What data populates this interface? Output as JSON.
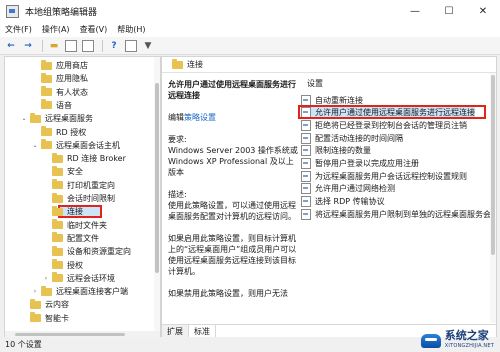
{
  "window": {
    "title": "本地组策略编辑器",
    "controls": {
      "minimize": "—",
      "maximize": "☐",
      "close": "✕"
    }
  },
  "menu": [
    "文件(F)",
    "操作(A)",
    "查看(V)",
    "帮助(H)"
  ],
  "toolbar": [
    "back-arrow-icon",
    "forward-arrow-icon",
    "up-folder-icon",
    "show-hide-tree-icon",
    "export-list-icon",
    "help-icon",
    "properties-icon",
    "filter-icon"
  ],
  "tree": {
    "items": [
      {
        "label": "应用商店",
        "indent": 2,
        "arrow": ""
      },
      {
        "label": "应用隐私",
        "indent": 2,
        "arrow": ""
      },
      {
        "label": "有人状态",
        "indent": 2,
        "arrow": ""
      },
      {
        "label": "语音",
        "indent": 2,
        "arrow": ""
      },
      {
        "label": "远程桌面服务",
        "indent": 1,
        "arrow": "⌄"
      },
      {
        "label": "RD 授权",
        "indent": 2,
        "arrow": ""
      },
      {
        "label": "远程桌面会话主机",
        "indent": 2,
        "arrow": "⌄"
      },
      {
        "label": "RD 连接 Broker",
        "indent": 3,
        "arrow": ""
      },
      {
        "label": "安全",
        "indent": 3,
        "arrow": ""
      },
      {
        "label": "打印机重定向",
        "indent": 3,
        "arrow": ""
      },
      {
        "label": "会话时间限制",
        "indent": 3,
        "arrow": ""
      },
      {
        "label": "连接",
        "indent": 3,
        "arrow": "",
        "selected": true
      },
      {
        "label": "临时文件夹",
        "indent": 3,
        "arrow": ""
      },
      {
        "label": "配置文件",
        "indent": 3,
        "arrow": ""
      },
      {
        "label": "设备和资源重定向",
        "indent": 3,
        "arrow": ""
      },
      {
        "label": "授权",
        "indent": 3,
        "arrow": ""
      },
      {
        "label": "远程会话环境",
        "indent": 3,
        "arrow": "›"
      },
      {
        "label": "远程桌面连接客户端",
        "indent": 2,
        "arrow": "›"
      },
      {
        "label": "云内容",
        "indent": 1,
        "arrow": ""
      },
      {
        "label": "智能卡",
        "indent": 1,
        "arrow": ""
      }
    ]
  },
  "panel": {
    "header": "连接",
    "description": {
      "title": "允许用户通过使用远程桌面服务进行远程连接",
      "edit_prefix": "编辑",
      "edit_link": "策略设置",
      "req_label": "要求:",
      "req_text": "Windows Server 2003 操作系统或 Windows XP Professional 及以上版本",
      "desc_label": "描述:",
      "desc_text": "使用此策略设置，可以通过使用远程桌面服务配置对计算机的远程访问。",
      "enabled_text": "如果启用此策略设置，则目标计算机上的“远程桌面用户”组成员用户可以使用远程桌面服务远程连接到该目标计算机。",
      "disabled_text": "如果禁用此策略设置，则用户无法"
    },
    "settings_header": "设置",
    "settings": [
      {
        "label": "自动重新连接",
        "selected": false
      },
      {
        "label": "允许用户通过使用远程桌面服务进行远程连接",
        "selected": true
      },
      {
        "label": "拒绝将已经登录到控制台会话的管理员注销",
        "selected": false
      },
      {
        "label": "配置活动连接的时间间隔",
        "selected": false
      },
      {
        "label": "限制连接的数量",
        "selected": false
      },
      {
        "label": "暂停用户登录以完成应用注册",
        "selected": false
      },
      {
        "label": "为远程桌面服务用户会话远程控制设置规则",
        "selected": false
      },
      {
        "label": "允许用户通过网络检测",
        "selected": false
      },
      {
        "label": "选择 RDP 传输协议",
        "selected": false
      },
      {
        "label": "将远程桌面服务用户限制到单独的远程桌面服务会话",
        "selected": false
      }
    ],
    "tabs": [
      "扩展",
      "标准"
    ]
  },
  "status": "10 个设置",
  "watermark": {
    "title": "系统之家",
    "url": "XITONGZHIJIA.NET"
  }
}
